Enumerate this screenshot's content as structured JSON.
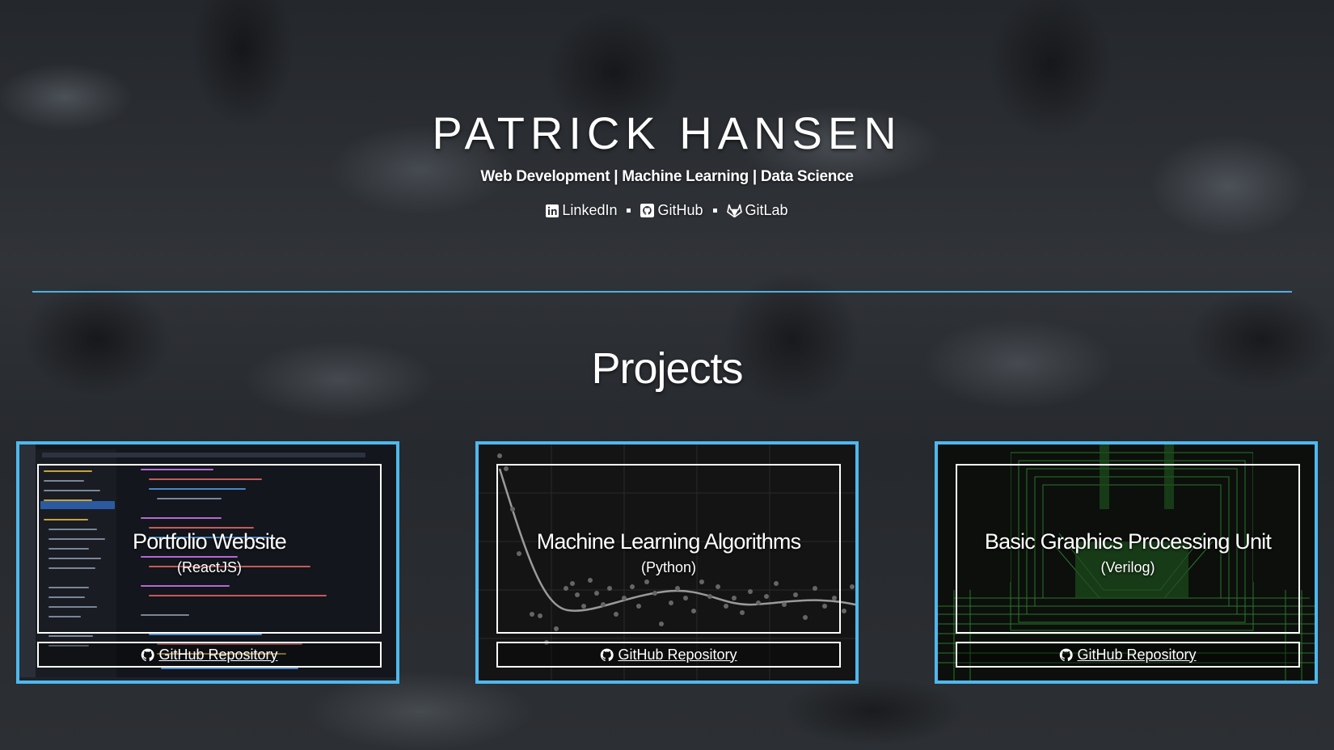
{
  "header": {
    "name": "PATRICK HANSEN",
    "tagline": "Web Development | Machine Learning | Data Science",
    "links": [
      {
        "label": "LinkedIn",
        "icon": "linkedin-icon"
      },
      {
        "label": "GitHub",
        "icon": "github-icon"
      },
      {
        "label": "GitLab",
        "icon": "gitlab-icon"
      }
    ]
  },
  "projects": {
    "title": "Projects",
    "items": [
      {
        "title": "Portfolio Website",
        "tech": "(ReactJS)",
        "button": "GitHub Repository",
        "button_icon": "github-icon"
      },
      {
        "title": "Machine Learning Algorithms",
        "tech": "(Python)",
        "button": "GitHub Repository",
        "button_icon": "github-icon"
      },
      {
        "title": "Basic Graphics Processing Unit",
        "tech": "(Verilog)",
        "button": "GitHub Repository",
        "button_icon": "github-icon"
      }
    ]
  },
  "colors": {
    "accent": "#4fb8ee",
    "text": "#ffffff",
    "circuit_green": "#2f8a2f"
  }
}
